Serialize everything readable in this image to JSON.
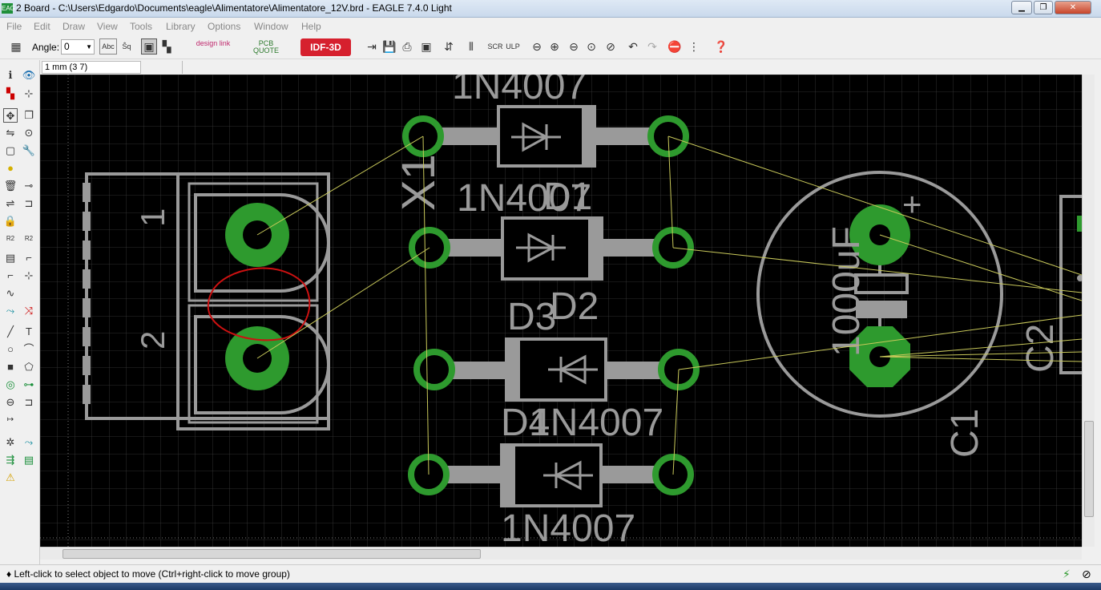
{
  "window": {
    "icon_text": "EAG",
    "title": "2 Board - C:\\Users\\Edgardo\\Documents\\eagle\\Alimentatore\\Alimentatore_12V.brd - EAGLE 7.4.0 Light"
  },
  "menu": [
    "File",
    "Edit",
    "Draw",
    "View",
    "Tools",
    "Library",
    "Options",
    "Window",
    "Help"
  ],
  "toolbar": {
    "angle_label": "Angle:",
    "angle_value": "0",
    "abc_label": "Abc",
    "design_link": "design link",
    "pcb_quote": "PCB QUOTE",
    "idf_button": "IDF-3D"
  },
  "coord_display": "1 mm (3 7)",
  "status_text": "♦ Left-click to select object to move (Ctrl+right-click to move group)",
  "board": {
    "connector": {
      "name": "X1",
      "pin1": "1",
      "pin2": "2"
    },
    "diodes": [
      {
        "name": "D1",
        "value": "1N4007"
      },
      {
        "name": "D2",
        "value": "1N4007"
      },
      {
        "name": "D3",
        "value": "1N4007"
      },
      {
        "name": "D4",
        "value": "1N4007"
      }
    ],
    "capacitor": {
      "name": "C1",
      "value": "1000uF",
      "plus": "+"
    },
    "capacitor2_label": "C2"
  },
  "colors": {
    "canvas": "#000000",
    "grid": "#2a2a2a",
    "silk": "#9a9a9a",
    "pad": "#2e9a2e",
    "airwire": "#c8c85a",
    "markup": "#cc1111",
    "idf_red": "#d6202e"
  }
}
